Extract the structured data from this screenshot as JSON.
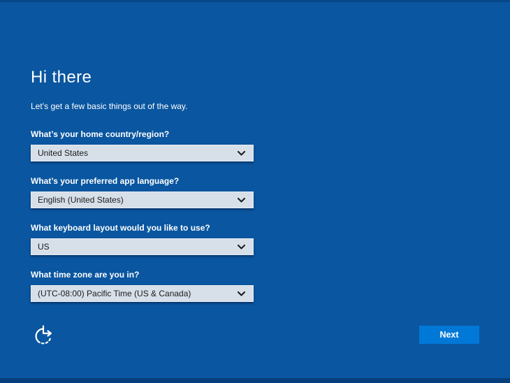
{
  "screen": {
    "title": "Hi there",
    "subtitle": "Let’s get a few basic things out of the way."
  },
  "form": {
    "fields": [
      {
        "label": "What’s your home country/region?",
        "value": "United States"
      },
      {
        "label": "What’s your preferred app language?",
        "value": "English (United States)"
      },
      {
        "label": "What keyboard layout would you like to use?",
        "value": "US"
      },
      {
        "label": "What time zone are you in?",
        "value": "(UTC-08:00) Pacific Time (US & Canada)"
      }
    ]
  },
  "footer": {
    "next_label": "Next",
    "ease_of_access_icon": "ease-of-access-icon",
    "chevron_icon": "chevron-down-icon"
  },
  "colors": {
    "background": "#0a56a0",
    "select_background": "#d7dfe9",
    "select_border": "#e9eef5",
    "select_text": "#1b1b1b",
    "accent_button": "#0078d7",
    "text": "#ffffff"
  }
}
